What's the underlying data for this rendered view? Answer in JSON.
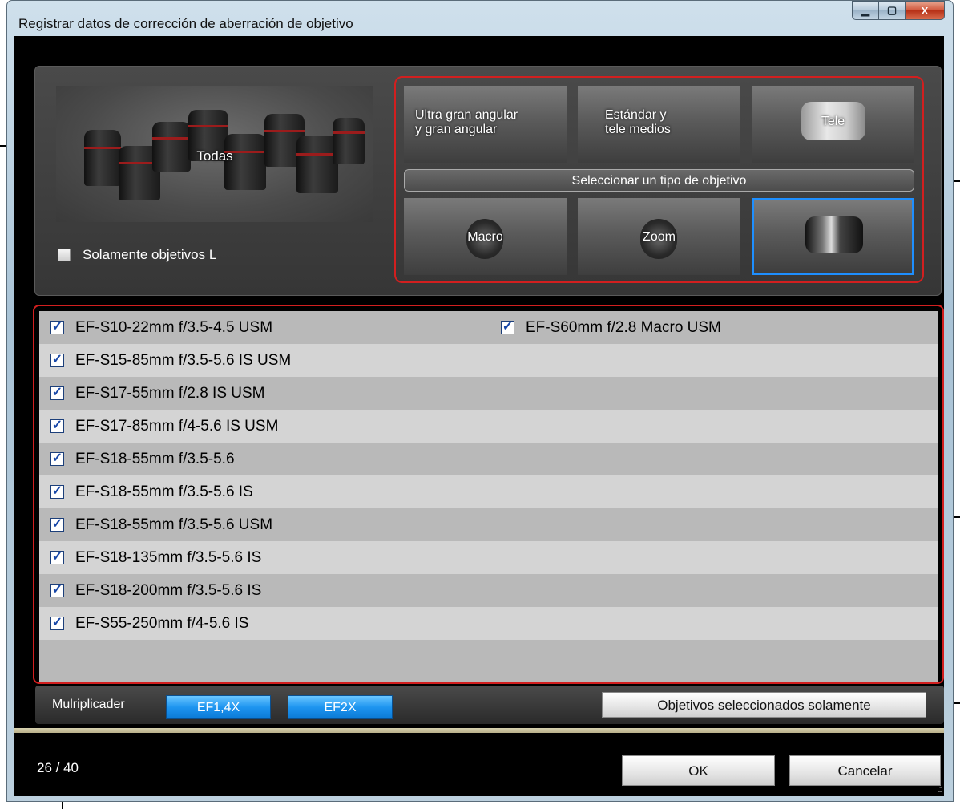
{
  "window": {
    "title": "Registrar datos de corrección de aberración de objetivo",
    "controls": {
      "minimize": "▁",
      "maximize": "▢",
      "close": "X"
    }
  },
  "all_lenses": {
    "label": "Todas",
    "l_only_label": "Solamente objetivos L",
    "l_only_checked": false
  },
  "lens_types": {
    "select_label": "Seleccionar un tipo de objetivo",
    "buttons": [
      {
        "line1": "Ultra gran angular",
        "line2": "y gran angular"
      },
      {
        "line1": "Estándar y",
        "line2": "tele medios"
      },
      {
        "line1": "Tele",
        "line2": ""
      },
      {
        "line1": "Macro",
        "line2": ""
      },
      {
        "line1": "Zoom",
        "line2": ""
      },
      {
        "line1": "",
        "line2": ""
      }
    ],
    "selected_index": 5
  },
  "lens_list": {
    "column1": [
      "EF-S10-22mm f/3.5-4.5 USM",
      "EF-S15-85mm f/3.5-5.6 IS USM",
      "EF-S17-55mm f/2.8 IS USM",
      "EF-S17-85mm f/4-5.6 IS USM",
      "EF-S18-55mm f/3.5-5.6",
      "EF-S18-55mm f/3.5-5.6 IS",
      "EF-S18-55mm f/3.5-5.6 USM",
      "EF-S18-135mm f/3.5-5.6 IS",
      "EF-S18-200mm f/3.5-5.6 IS",
      "EF-S55-250mm f/4-5.6 IS"
    ],
    "column2": [
      "EF-S60mm f/2.8 Macro USM"
    ],
    "check_mark": "✓"
  },
  "multiplier": {
    "label": "Mulriplicader",
    "ef14": "EF1,4X",
    "ef2": "EF2X",
    "selected_only": "Objetivos seleccionados solamente"
  },
  "footer": {
    "count": "26 / 40",
    "ok": "OK",
    "cancel": "Cancelar",
    "grip": ".::"
  },
  "colors": {
    "highlight_border": "#d21f1f",
    "selected_border": "#1e8fff",
    "multiplier_button": "#1e95f0"
  }
}
